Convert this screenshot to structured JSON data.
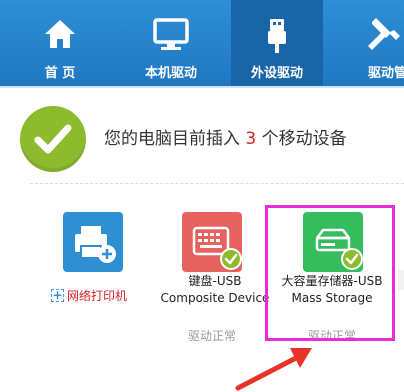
{
  "nav": {
    "items": [
      {
        "label": "首 页",
        "icon": "home-icon"
      },
      {
        "label": "本机驱动",
        "icon": "monitor-icon"
      },
      {
        "label": "外设驱动",
        "icon": "usb-icon"
      },
      {
        "label": "驱动管",
        "icon": "wrench-icon"
      }
    ],
    "active_index": 2
  },
  "status": {
    "prefix": "您的电脑目前插入",
    "count": "3",
    "suffix": "个移动设备"
  },
  "devices": [
    {
      "name_line1": "",
      "name_line2": "",
      "status": "",
      "icon": "printer-icon",
      "color": "#2f8fd3"
    },
    {
      "name_line1": "键盘-USB",
      "name_line2": "Composite Device",
      "status": "驱动正常",
      "icon": "keyboard-icon",
      "color": "#e6625e"
    },
    {
      "name_line1": "大容量存储器-USB",
      "name_line2": "Mass Storage",
      "status": "驱动正常",
      "icon": "storage-icon",
      "color": "#35bd5d"
    }
  ],
  "add_printer": {
    "box": "+",
    "label": "网络打印机"
  },
  "colors": {
    "nav": "#1f77c2",
    "accent_red": "#d3242a",
    "check_green": "#8dbb2d",
    "highlight": "#e92bd9"
  }
}
